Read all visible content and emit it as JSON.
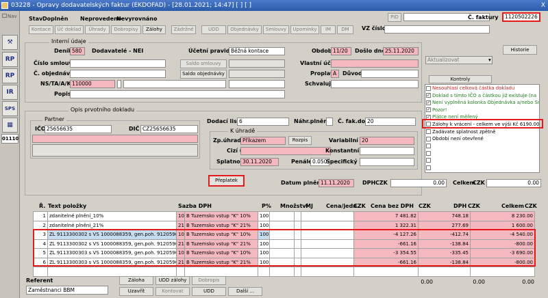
{
  "window": {
    "title": "03228 - Opravy dodavatelských faktur (EKDOFAD) - [28.01.2021; 14:47] [ ] [ ]",
    "close": "X"
  },
  "left": {
    "nav": "Nav",
    "buttons": [
      "RP",
      "RP",
      "IR"
    ],
    "code": "01110"
  },
  "status": {
    "stav_label": "Stav",
    "stav": "Doplněn",
    "neprovedeno": "Neprovedeno",
    "nevyrovnano": "Nevyrovnáno"
  },
  "toolbar": [
    "Kontace",
    "Úč doklad",
    "Úhrady",
    "Dobropisy",
    "Zálohy",
    "Zádržné",
    "UDD",
    "Objednávky",
    "Smlouvy",
    "Upomínky",
    "IM",
    "DM"
  ],
  "pid": {
    "label": "PID",
    "value": ""
  },
  "vs_cislo": {
    "label": "VZ číslo",
    "value": ""
  },
  "cislo_faktury": {
    "label": "Č. faktury",
    "value": "1120502226"
  },
  "interni": {
    "title": "Interní údaje",
    "denik_label": "Deník",
    "denik_code": "580",
    "denik_name": "Dodavatelé - NEI",
    "ucetni_label": "Účetní pravidlo",
    "ucetni_value": "Běžná kontace",
    "obdobi_label": "Období",
    "obdobi_value": "11/20",
    "doslo_label": "Došlo dne",
    "doslo_value": "25.11.2020",
    "historie": "Historie",
    "cislo_smlouvy_label": "Číslo smlouvy",
    "saldo_smlouvy": "Saldo smlouvy",
    "vlastni_label": "Vlastní účet",
    "aktualizovat": "Aktualizovat",
    "c_objednavky_label": "Č. objednávky",
    "saldo_objednavky": "Saldo objednávky",
    "proplatit_label": "Proplatit",
    "proplatit_value": "A",
    "duvod_label": "Důvod",
    "nstaakp_label": "NS/TA/A/KP",
    "nstaakp_value": "110000",
    "schvaluje_label": "Schvaluje",
    "popis_label": "Popis",
    "kontroly": "Kontroly"
  },
  "checks": [
    {
      "text": "Nesouhlasí celková částka dokladu",
      "color": "#d02020",
      "checked": false
    },
    {
      "text": "Doklad s tímto IČO a částkou již existuje (na",
      "color": "#208020",
      "checked": true
    },
    {
      "text": "Není vyplněná kolonka Objednávka a/nebo Sr",
      "color": "#208020",
      "checked": true
    },
    {
      "text": "Pozor!",
      "color": "#208020",
      "checked": true
    },
    {
      "text": "Plátce není měřený",
      "color": "#208020",
      "checked": true
    },
    {
      "text": "Zálohy k vrácení - celkem ve výši Kč 6190.00",
      "color": "#000000",
      "checked": false
    },
    {
      "text": "Zadávate splatnost zpětně",
      "color": "#000000",
      "checked": false
    },
    {
      "text": "Období není otevřené",
      "color": "#000000",
      "checked": false
    },
    {
      "text": "",
      "color": "#000000",
      "checked": false
    },
    {
      "text": "",
      "color": "#000000",
      "checked": false
    },
    {
      "text": "",
      "color": "#000000",
      "checked": false
    },
    {
      "text": "",
      "color": "#000000",
      "checked": false
    }
  ],
  "opis": {
    "title": "Opis prvotního dokladu",
    "partner_title": "Partner",
    "ico_label": "IČO",
    "ico": "25656635",
    "dic_label": "DIČ",
    "dic": "CZ25656635",
    "dodaci_label": "Dodací list",
    "dodaci": "6",
    "nahr_label": "Náhr.plnění",
    "c_fak_label": "Č. fak.dod",
    "c_fak": "20"
  },
  "uhrada": {
    "title": "K úhradě",
    "zp_label": "Zp.úhrady",
    "zp_value": "Příkazem",
    "rozpis": "Rozpis",
    "variabilni_label": "Variabilní s.",
    "variabilni": "20",
    "cizi_label": "Cizí účet",
    "konstantni_label": "Konstantní s.",
    "splatnost_label": "Splatnost",
    "splatnost": "30.11.2020",
    "penale_label": "Penále",
    "penale": "0.050",
    "specificky_label": "Specifický s."
  },
  "preplatek": "Přeplatek",
  "datum": {
    "label": "Datum plnění",
    "value": "11.11.2020",
    "dph_label": "DPH",
    "czk": "CZK",
    "dph_value": "0.00",
    "celkem_label": "Celkem",
    "celkem_value": "0.00"
  },
  "grid": {
    "headers": {
      "r": "Ř.",
      "text": "Text položky",
      "sazba": "Sazba DPH",
      "p": "P%",
      "mnozstvi": "Množství",
      "mj": "MJ",
      "cena": "Cena/jedn.",
      "czk": "CZK",
      "bez": "Cena bez DPH",
      "bezczk": "CZK",
      "dph": "DPH",
      "dphczk": "CZK",
      "celkem": "Celkem",
      "celczk": "CZK"
    },
    "rows": [
      {
        "r": "1",
        "text": "zdanitelné plnění_10%",
        "sc": "10",
        "sd": "B Tuzemsko vstup \"K\" 10%",
        "p": "100",
        "bez": "7 481.82",
        "dph": "748.18",
        "cel": "8 230.00"
      },
      {
        "r": "2",
        "text": "zdanitelné plnění_21%",
        "sc": "21",
        "sd": "B Tuzemsko vstup \"K\" 21%",
        "p": "100",
        "bez": "1 322.31",
        "dph": "277.69",
        "cel": "1 600.00"
      },
      {
        "r": "3",
        "text": "ZL 9113300302 s VS 1000088359, gen.poh. 9120590004,",
        "sc": "10",
        "sd": "B Tuzemsko vstup \"K\" 10%",
        "p": "100",
        "bez": "-4 127.26",
        "dph": "-412.74",
        "cel": "-4 540.00"
      },
      {
        "r": "4",
        "text": "ZL 9113300302 s VS 1000088359, gen.poh. 9120590004,",
        "sc": "21",
        "sd": "B Tuzemsko vstup \"K\" 21%",
        "p": "100",
        "bez": "-661.16",
        "dph": "-138.84",
        "cel": "-800.00"
      },
      {
        "r": "5",
        "text": "ZL 9113300303 s VS 1000088359, gen.poh. 9120590005,",
        "sc": "10",
        "sd": "B Tuzemsko vstup \"K\" 10%",
        "p": "100",
        "bez": "-3 354.55",
        "dph": "-335.45",
        "cel": "-3 690.00"
      },
      {
        "r": "6",
        "text": "ZL 9113300303 s VS 1000088359, gen.poh. 9120590005,",
        "sc": "21",
        "sd": "B Tuzemsko vstup \"K\" 21%",
        "p": "100",
        "bez": "-661.16",
        "dph": "-138.84",
        "cel": "-800.00"
      },
      {
        "r": "",
        "text": "",
        "sc": "",
        "sd": "",
        "p": "",
        "bez": "",
        "dph": "",
        "cel": ""
      }
    ],
    "totals": {
      "bez": "0.00",
      "dph": "0.00",
      "cel": "0.00"
    }
  },
  "bottom": {
    "referent_label": "Referent",
    "referent": "Zaměstnanci BBM",
    "zaloha": "Záloha",
    "udd_zalohy": "UDD zálohy",
    "dobropis": "Dobropis",
    "uzavrit": "Uzavřít",
    "kontovat": "Kontovat",
    "udd": "UDD",
    "dalsi": "Další ..."
  }
}
